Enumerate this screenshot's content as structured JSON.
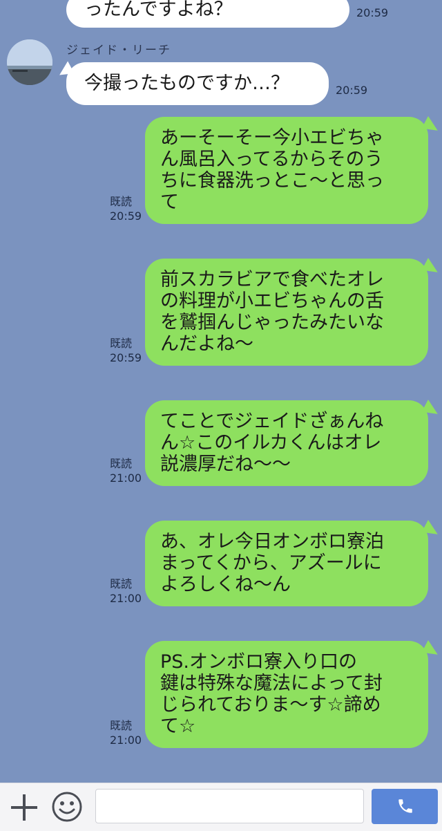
{
  "contact": {
    "name": "ジェイド・リーチ"
  },
  "messages": [
    {
      "side": "in",
      "text": "ったんですよね？",
      "time": "20:59"
    },
    {
      "side": "in",
      "text": "今撮ったものですか…？",
      "time": "20:59"
    },
    {
      "side": "out",
      "lines": [
        "あーそーそー今小エビちゃ",
        "ん風呂入ってるからそのう",
        "ちに食器洗っとこ〜と思っ",
        "て"
      ],
      "read": "既読",
      "time": "20:59"
    },
    {
      "side": "out",
      "lines": [
        "前スカラビアで食べたオレ",
        "の料理が小エビちゃんの舌",
        "を鷲掴んじゃったみたいな",
        "んだよね〜"
      ],
      "read": "既読",
      "time": "20:59"
    },
    {
      "side": "out",
      "lines": [
        "てことでジェイドざぁんね",
        "ん☆このイルカくんはオレ",
        "説濃厚だね〜〜"
      ],
      "read": "既読",
      "time": "21:00"
    },
    {
      "side": "out",
      "lines": [
        "あ、オレ今日オンボロ寮泊",
        "まってくから、アズールに",
        "よろしくね〜ん"
      ],
      "read": "既読",
      "time": "21:00"
    },
    {
      "side": "out",
      "lines": [
        "PS.オンボロ寮入り口の",
        "鍵は特殊な魔法によって封",
        "じられておりま〜す☆諦め",
        "て☆"
      ],
      "read": "既読",
      "time": "21:00"
    }
  ],
  "input": {
    "placeholder": "",
    "value": ""
  },
  "colors": {
    "background": "#7b93bf",
    "incoming": "#ffffff",
    "outgoing": "#8ee05f",
    "call_button": "#5a86d8"
  },
  "icons": {
    "add": "plus-icon",
    "emoji": "smiley-icon",
    "call": "phone-icon"
  }
}
